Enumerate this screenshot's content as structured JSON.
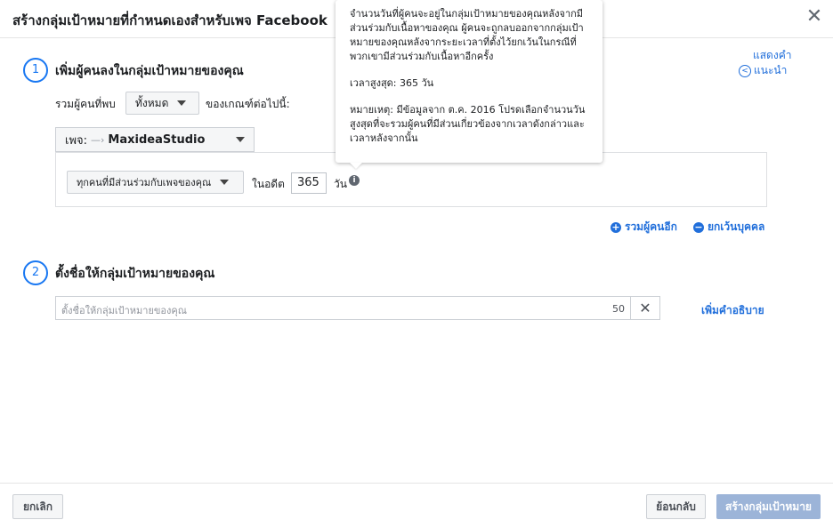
{
  "dialog": {
    "title": "สร้างกลุ่มเป้าหมายที่กำหนดเองสำหรับเพจ Facebook",
    "close_glyph": "✕"
  },
  "help_link": {
    "line1": "แสดงคำ",
    "line2": "แนะนำ"
  },
  "step1": {
    "number": "1",
    "title": "เพิ่มผู้คนลงในกลุ่มเป้าหมายของคุณ",
    "include_label": "รวมผู้คนที่พบ",
    "match_dropdown": "ทั้งหมด",
    "criteria_label": "ของเกณฑ์ต่อไปนี้:",
    "page_select": {
      "prefix": "เพจ:",
      "page_name": "MaxideaStudio"
    },
    "rule": {
      "event_dropdown": "ทุกคนที่มีส่วนร่วมกับเพจของคุณ",
      "in_past_label": "ในอดีต",
      "days_value": "365",
      "days_unit": "วัน"
    },
    "include_more": "รวมผู้คนอีก",
    "exclude": "ยกเว้นบุคคล"
  },
  "tooltip": {
    "para1": "จำนวนวันที่ผู้คนจะอยู่ในกลุ่มเป้าหมายของคุณหลังจากมีส่วนร่วมกับเนื้อหาของคุณ ผู้คนจะถูกลบออกจากกลุ่มเป้าหมายของคุณหลังจากระยะเวลาที่ตั้งไว้ยกเว้นในกรณีที่พวกเขามีส่วนร่วมกับเนื้อหาอีกครั้ง",
    "para2": "เวลาสูงสุด: 365 วัน",
    "para3": "หมายเหตุ: มีข้อมูลจาก ต.ค. 2016 โปรดเลือกจำนวนวันสูงสุดที่จะรวมผู้คนที่มีส่วนเกี่ยวข้องจากเวลาดังกล่าวและเวลาหลังจากนั้น"
  },
  "step2": {
    "number": "2",
    "title": "ตั้งชื่อให้กลุ่มเป้าหมายของคุณ",
    "name_placeholder": "ตั้งชื่อให้กลุ่มเป้าหมายของคุณ",
    "char_count": "50",
    "add_description": "เพิ่มคำอธิบาย"
  },
  "footer": {
    "cancel": "ยกเลิก",
    "back": "ย้อนกลับ",
    "create": "สร้างกลุ่มเป้าหมาย"
  }
}
